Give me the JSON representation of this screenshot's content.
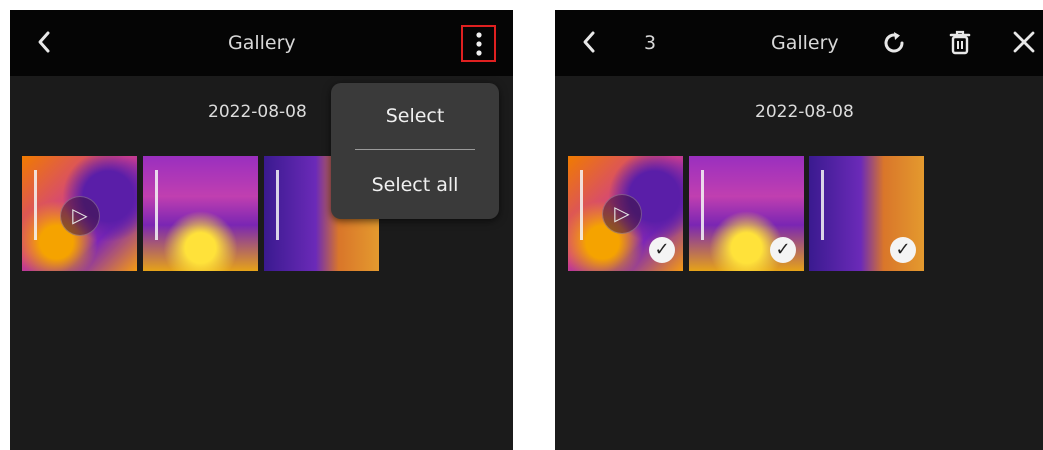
{
  "left_screen": {
    "header": {
      "title": "Gallery",
      "back_icon": "back-icon",
      "more_icon": "more-vertical-icon"
    },
    "date": "2022-08-08",
    "menu": {
      "items": [
        "Select",
        "Select all"
      ]
    },
    "thumbnails": [
      {
        "type": "video",
        "icon": "play-icon"
      },
      {
        "type": "image"
      },
      {
        "type": "image"
      }
    ],
    "highlight_color": "#e02020"
  },
  "right_screen": {
    "header": {
      "back_icon": "back-icon",
      "count": "3",
      "title": "Gallery",
      "icons": [
        "rotate-icon",
        "trash-icon",
        "close-icon"
      ]
    },
    "date": "2022-08-08",
    "thumbnails": [
      {
        "type": "video",
        "icon": "play-icon",
        "selected": true
      },
      {
        "type": "image",
        "selected": true
      },
      {
        "type": "image",
        "selected": true
      }
    ]
  }
}
